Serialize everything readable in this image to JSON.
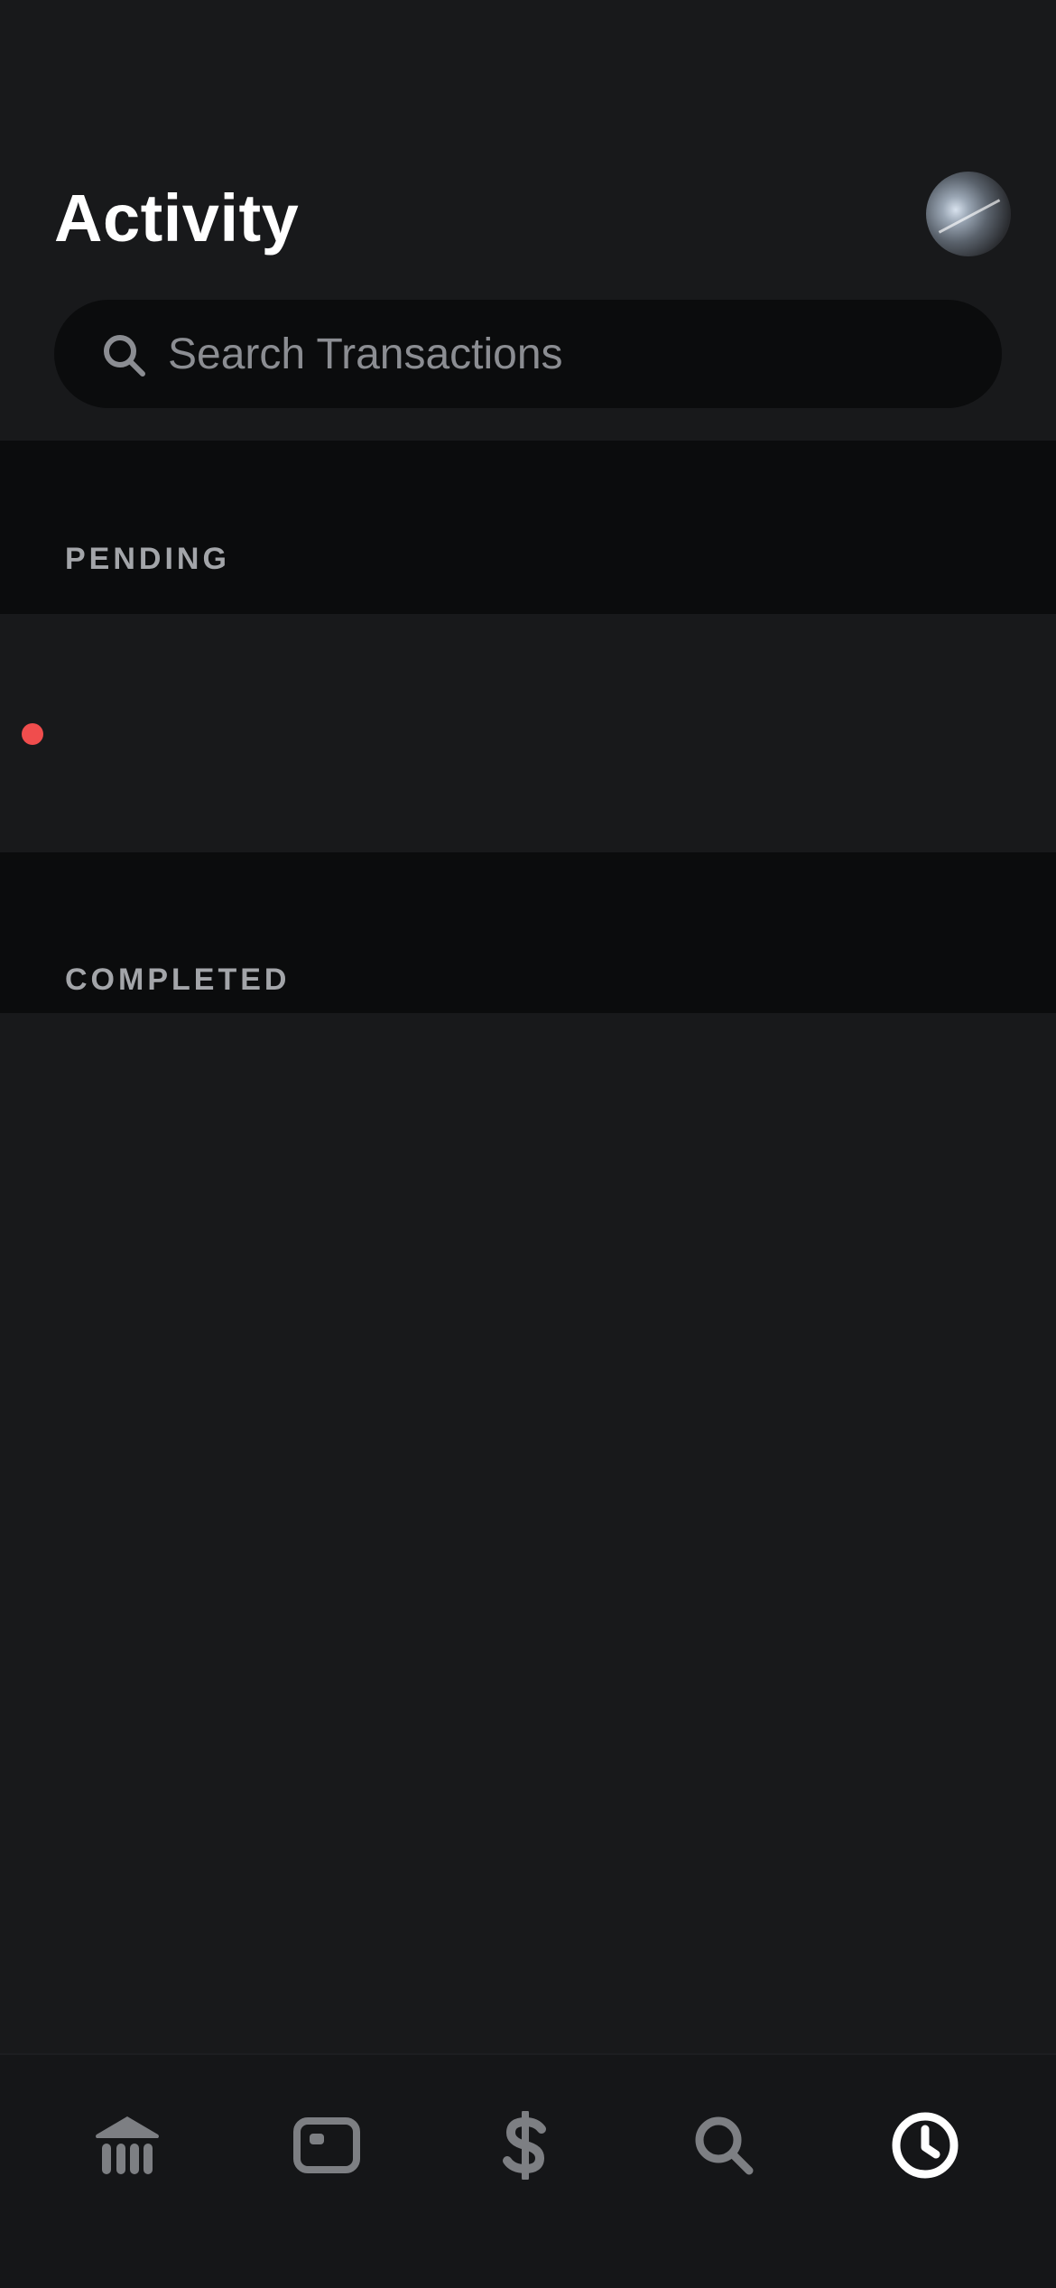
{
  "header": {
    "title": "Activity"
  },
  "search": {
    "placeholder": "Search Transactions",
    "value": ""
  },
  "sections": {
    "pending": {
      "label": "PENDING"
    },
    "completed": {
      "label": "COMPLETED"
    }
  },
  "bottom_nav": {
    "items": [
      {
        "icon": "bank-icon",
        "active": false
      },
      {
        "icon": "card-icon",
        "active": false
      },
      {
        "icon": "dollar-icon",
        "active": false
      },
      {
        "icon": "search-icon",
        "active": false
      },
      {
        "icon": "clock-icon",
        "active": true
      }
    ]
  },
  "colors": {
    "background": "#18191b",
    "section_background": "#0b0c0d",
    "accent_dot": "#f04d4d",
    "inactive_icon": "#7d7f83",
    "active_icon": "#ffffff"
  }
}
